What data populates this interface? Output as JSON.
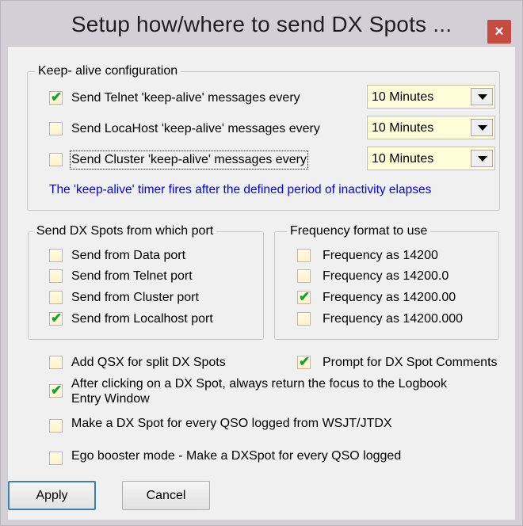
{
  "window": {
    "title": "Setup how/where to send DX Spots ...",
    "close_glyph": "×"
  },
  "keepalive": {
    "legend": "Keep- alive configuration",
    "rows": [
      {
        "label": "Send Telnet 'keep-alive' messages every",
        "checked": true,
        "interval": "10 Minutes"
      },
      {
        "label": "Send LocaHost 'keep-alive' messages every",
        "checked": false,
        "interval": "10 Minutes"
      },
      {
        "label": "Send Cluster 'keep-alive' messages every",
        "checked": false,
        "interval": "10 Minutes"
      }
    ],
    "note": "The 'keep-alive' timer fires after the defined period of inactivity elapses"
  },
  "port": {
    "legend": "Send DX Spots from which port",
    "options": [
      {
        "label": "Send from Data port",
        "checked": false
      },
      {
        "label": "Send from Telnet port",
        "checked": false
      },
      {
        "label": "Send from Cluster port",
        "checked": false
      },
      {
        "label": "Send from Localhost port",
        "checked": true
      }
    ]
  },
  "frequency": {
    "legend": "Frequency format to use",
    "options": [
      {
        "label": "Frequency as 14200",
        "checked": false
      },
      {
        "label": "Frequency as 14200.0",
        "checked": false
      },
      {
        "label": "Frequency as 14200.00",
        "checked": true
      },
      {
        "label": "Frequency as 14200.000",
        "checked": false
      }
    ]
  },
  "options": {
    "add_qsx": {
      "label": "Add QSX for split DX Spots",
      "checked": false
    },
    "prompt_comments": {
      "label": "Prompt for DX Spot Comments",
      "checked": true
    },
    "return_focus": {
      "label_line1": "After clicking on a DX Spot, always return the focus to the Logbook",
      "label_line2": "Entry Window",
      "checked": true
    },
    "wsjt_spot": {
      "label": "Make a DX Spot for every QSO logged from WSJT/JTDX",
      "checked": false
    },
    "ego_booster": {
      "label": "Ego booster mode - Make a DXSpot for every QSO logged",
      "checked": false
    }
  },
  "buttons": {
    "apply": "Apply",
    "cancel": "Cancel"
  },
  "colors": {
    "checkmark": "#11a330",
    "note_text": "#0000ee",
    "close_button": "#c84b41"
  },
  "icons": {
    "check": "✔"
  }
}
